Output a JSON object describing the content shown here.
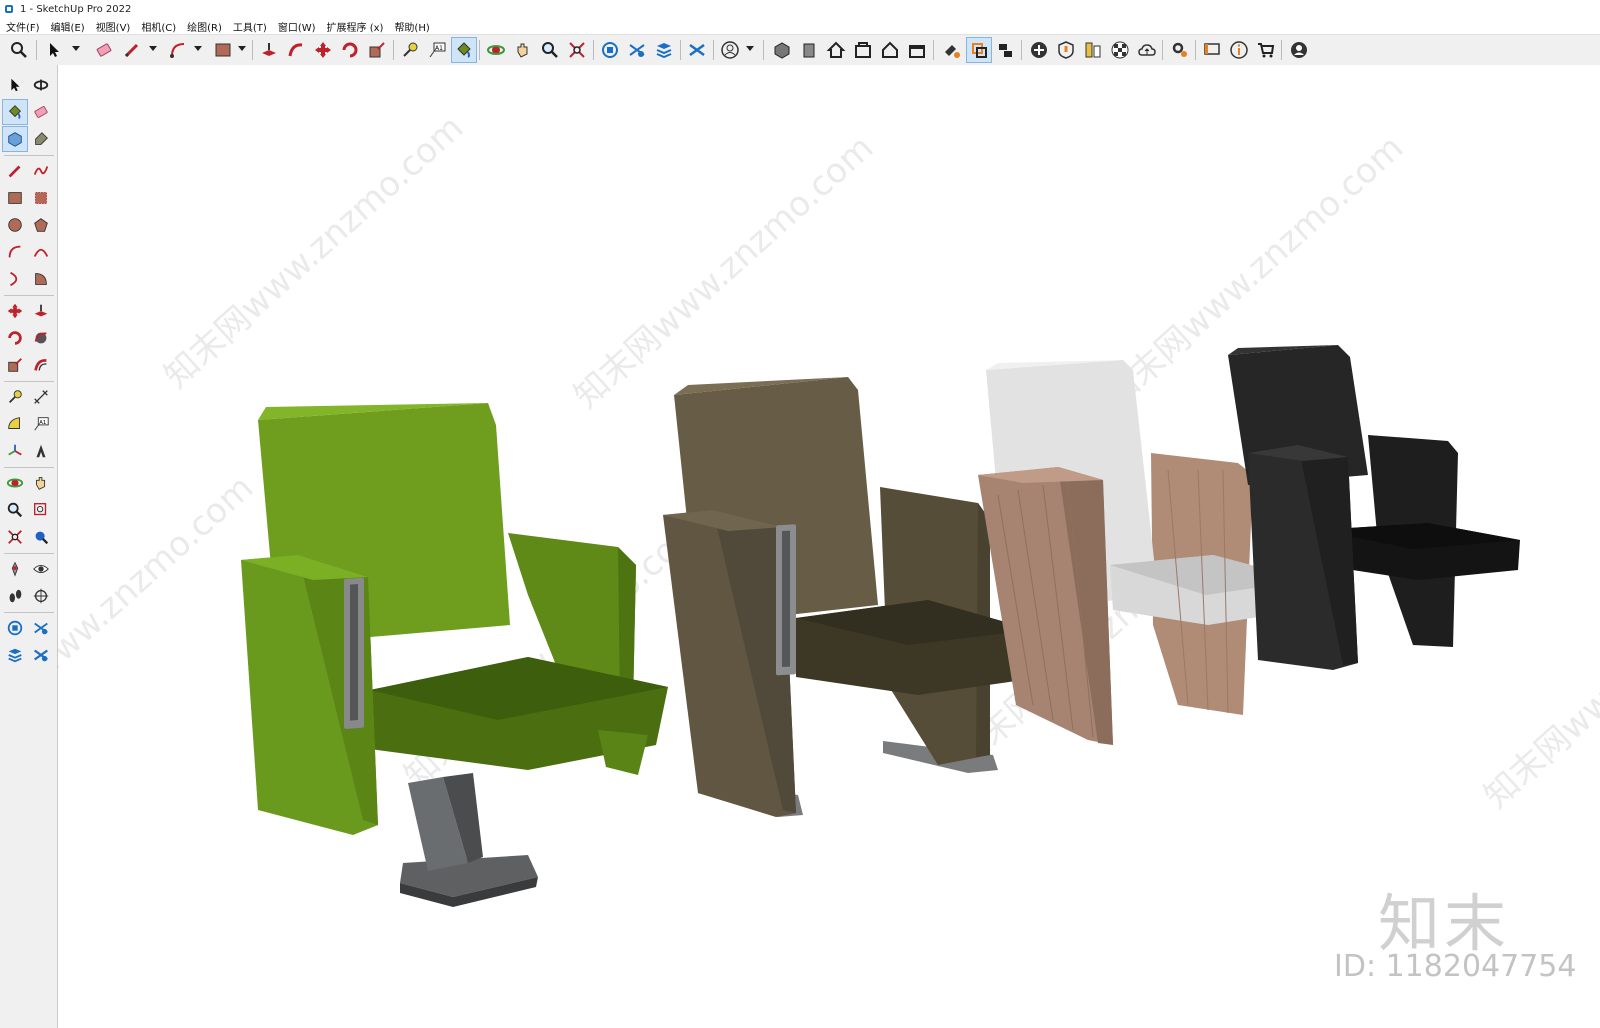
{
  "window": {
    "title": "1 - SketchUp Pro 2022"
  },
  "menu": [
    {
      "label": "文件(F)"
    },
    {
      "label": "编辑(E)"
    },
    {
      "label": "视图(V)"
    },
    {
      "label": "相机(C)"
    },
    {
      "label": "绘图(R)"
    },
    {
      "label": "工具(T)"
    },
    {
      "label": "窗口(W)"
    },
    {
      "label": "扩展程序 (x)"
    },
    {
      "label": "帮助(H)"
    }
  ],
  "toolbar": {
    "icons": [
      "search-icon",
      "select-arrow-icon",
      "eraser-icon",
      "pencil-icon",
      "arc-icon",
      "rectangle-icon",
      "push-pull-icon",
      "follow-me-icon",
      "move-icon",
      "rotate-icon",
      "scale-icon",
      "tape-measure-icon",
      "text-label-icon",
      "paint-bucket-icon",
      "orbit-icon",
      "pan-icon",
      "zoom-icon",
      "zoom-extents-icon",
      "warehouse-icon",
      "extension-warehouse-icon",
      "layout-icon",
      "extension-manager-icon",
      "user-account-icon",
      "iso-view-icon",
      "front-view-icon",
      "home-view-icon",
      "top-view-icon",
      "right-view-icon",
      "back-view-icon",
      "left-view-icon",
      "section-plane-icon",
      "section-display-icon",
      "camera-icon",
      "add-icon",
      "info-shield-icon",
      "materials-icon",
      "checker-icon",
      "cloud-upload-icon",
      "gear-settings-icon",
      "message-icon",
      "info-icon",
      "cart-icon",
      "profile-icon"
    ]
  },
  "left_toolbar": {
    "icons": [
      "select-icon",
      "orbit-icon",
      "paint-bucket-icon",
      "eraser-icon",
      "component-icon",
      "tag-icon",
      "line-icon",
      "freehand-icon",
      "rectangle-icon",
      "rotated-rectangle-icon",
      "circle-icon",
      "polygon-icon",
      "arc-icon",
      "two-point-arc-icon",
      "three-point-arc-icon",
      "pie-icon",
      "move-icon",
      "push-pull-icon",
      "rotate-icon",
      "follow-me-icon",
      "scale-icon",
      "offset-icon",
      "tape-measure-icon",
      "dimension-icon",
      "protractor-icon",
      "text-icon",
      "axes-icon",
      "3d-text-icon",
      "orbit-tool-icon",
      "pan-tool-icon",
      "zoom-tool-icon",
      "zoom-window-icon",
      "zoom-extents-tool-icon",
      "previous-view-icon",
      "position-camera-icon",
      "look-around-icon",
      "walk-icon",
      "section-plane-tool-icon",
      "warehouse-tool-icon",
      "extension-warehouse-tool-icon",
      "layout-tool-icon",
      "extension-manager-tool-icon"
    ]
  },
  "scene": {
    "models": [
      {
        "name": "green-chair",
        "color": "#6e9a1c"
      },
      {
        "name": "olive-chair",
        "color": "#5f5641"
      },
      {
        "name": "white-wood-chair",
        "color": "#e4e4e4"
      },
      {
        "name": "black-chair",
        "color": "#222222"
      }
    ],
    "watermark_text": "知末网www.znzmo.com",
    "brand_mark": "知末",
    "id_label": "ID: 1182047754"
  }
}
